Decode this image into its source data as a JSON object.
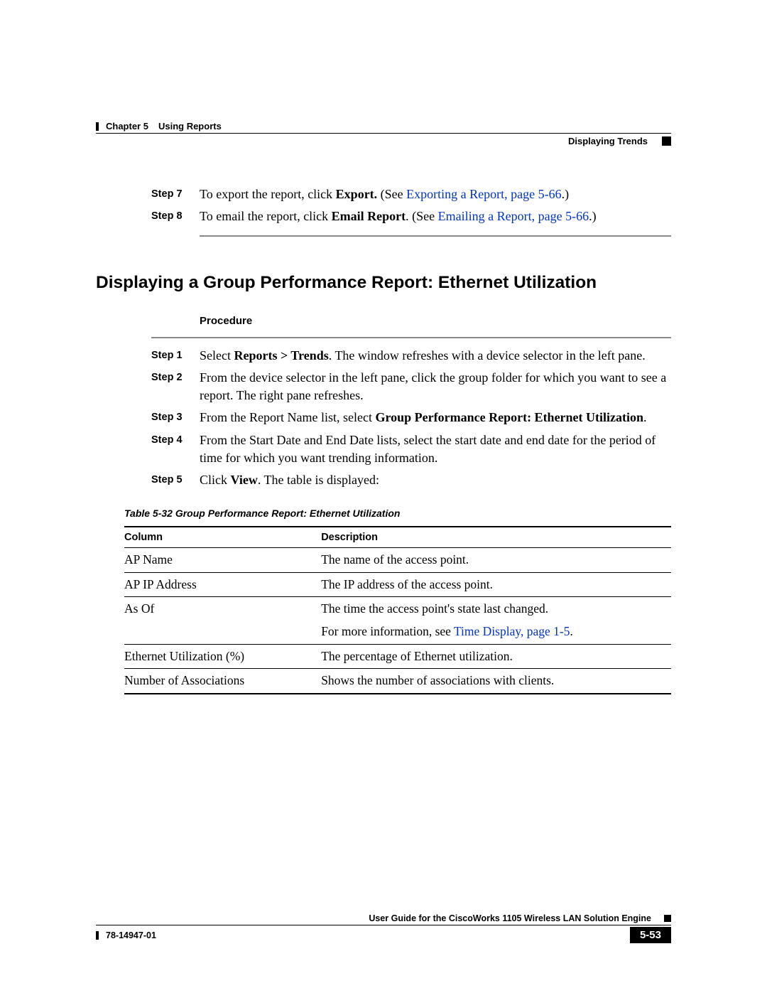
{
  "header": {
    "chapter_label": "Chapter 5",
    "chapter_name": "Using Reports",
    "subheader": "Displaying Trends"
  },
  "top_steps": [
    {
      "label": "Step 7",
      "parts": [
        {
          "t": "To export the report, click "
        },
        {
          "t": "Export.",
          "bold": true
        },
        {
          "t": " (See "
        },
        {
          "t": "Exporting a Report, page 5-66",
          "link": true
        },
        {
          "t": ".)"
        }
      ]
    },
    {
      "label": "Step 8",
      "parts": [
        {
          "t": "To email the report, click "
        },
        {
          "t": "Email Report",
          "bold": true
        },
        {
          "t": ". (See "
        },
        {
          "t": "Emailing a Report, page 5-66",
          "link": true
        },
        {
          "t": ".)"
        }
      ]
    }
  ],
  "heading": "Displaying a Group Performance Report: Ethernet Utilization",
  "procedure_label": "Procedure",
  "procedure_steps": [
    {
      "label": "Step 1",
      "parts": [
        {
          "t": "Select "
        },
        {
          "t": "Reports > Trends",
          "bold": true
        },
        {
          "t": ". The window refreshes with a device selector in the left pane."
        }
      ]
    },
    {
      "label": "Step 2",
      "parts": [
        {
          "t": "From the device selector in the left pane, click the group folder for which you want to see a report. The right pane refreshes."
        }
      ]
    },
    {
      "label": "Step 3",
      "parts": [
        {
          "t": "From the Report Name list, select "
        },
        {
          "t": "Group Performance Report: Ethernet Utilization",
          "bold": true
        },
        {
          "t": "."
        }
      ]
    },
    {
      "label": "Step 4",
      "parts": [
        {
          "t": "From the Start Date and End Date lists, select the start date and end date for the period of time for which you want trending information."
        }
      ]
    },
    {
      "label": "Step 5",
      "parts": [
        {
          "t": "Click "
        },
        {
          "t": "View",
          "bold": true
        },
        {
          "t": ". The table is displayed:"
        }
      ]
    }
  ],
  "table_caption": "Table 5-32    Group Performance Report: Ethernet Utilization",
  "table_headers": {
    "col": "Column",
    "desc": "Description"
  },
  "table_rows": [
    {
      "col": "AP Name",
      "desc_parts": [
        {
          "t": "The name of the access point."
        }
      ]
    },
    {
      "col": "AP IP Address",
      "desc_parts": [
        {
          "t": "The IP address of the access point."
        }
      ]
    },
    {
      "col": "As Of",
      "desc_parts": [
        {
          "t": "The time the access point's state last changed."
        },
        {
          "br": true
        },
        {
          "t": "For more information, see "
        },
        {
          "t": "Time Display, page 1-5",
          "link": true
        },
        {
          "t": "."
        }
      ]
    },
    {
      "col": "Ethernet Utilization (%)",
      "desc_parts": [
        {
          "t": "The percentage of Ethernet utilization."
        }
      ]
    },
    {
      "col": "Number of Associations",
      "desc_parts": [
        {
          "t": "Shows the number of associations with clients."
        }
      ]
    }
  ],
  "footer": {
    "guide": "User Guide for the CiscoWorks 1105 Wireless LAN Solution Engine",
    "doc_number": "78-14947-01",
    "page_number": "5-53"
  }
}
